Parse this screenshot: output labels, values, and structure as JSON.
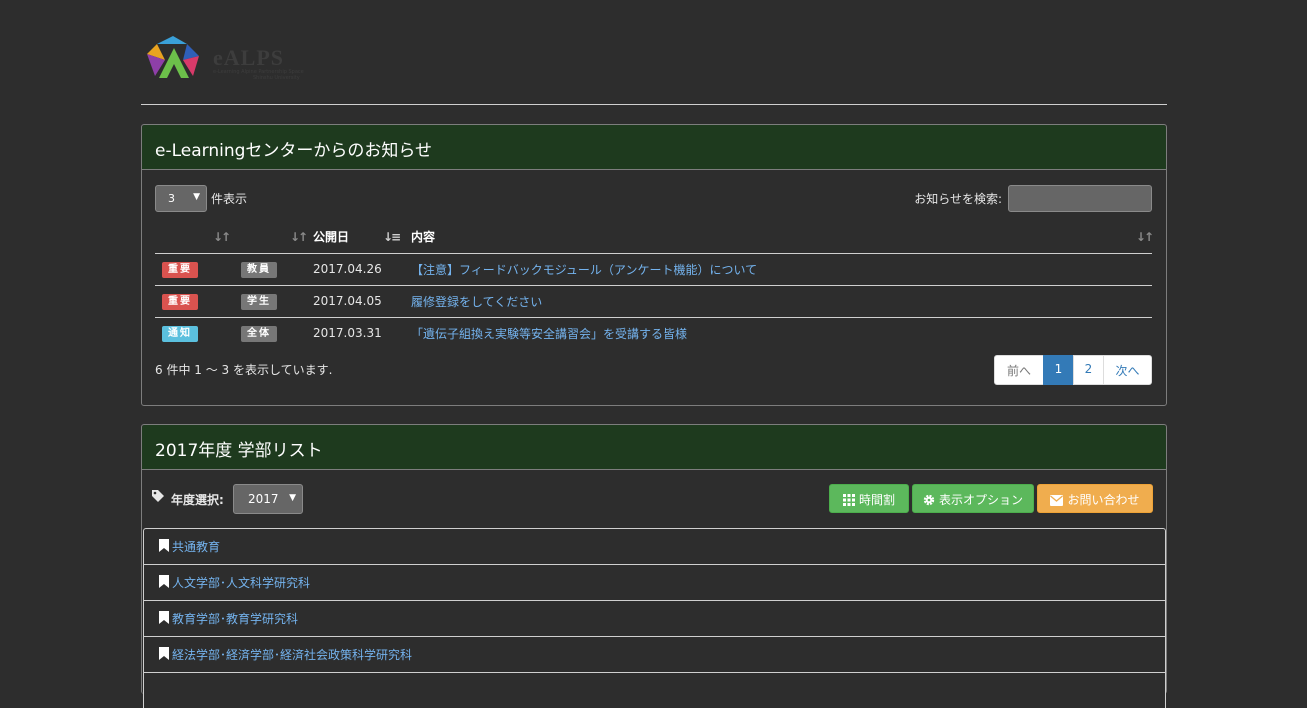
{
  "header": {
    "logo_text": "eALPS",
    "logo_sub1": "e-Learning Alpine Partnership Space",
    "logo_sub2": "Shinshu University"
  },
  "news_panel": {
    "title": "e-Learningセンターからのお知らせ",
    "page_length": "3",
    "page_length_suffix": "件表示",
    "search_label": "お知らせを検索:",
    "search_value": "",
    "columns": [
      "",
      "",
      "公開日",
      "内容"
    ],
    "rows": [
      {
        "importance": "重要",
        "importance_type": "danger",
        "target": "教員",
        "date": "2017.04.26",
        "content": "【注意】フィードバックモジュール（アンケート機能）について"
      },
      {
        "importance": "重要",
        "importance_type": "danger",
        "target": "学生",
        "date": "2017.04.05",
        "content": "履修登録をしてください"
      },
      {
        "importance": "通知",
        "importance_type": "info",
        "target": "全体",
        "date": "2017.03.31",
        "content": "「遺伝子組換え実験等安全講習会」を受講する皆様"
      }
    ],
    "info_text": "6 件中 1 〜 3 を表示しています.",
    "pagination": {
      "prev": "前へ",
      "pages": [
        "1",
        "2"
      ],
      "active_page": "1",
      "next": "次へ"
    }
  },
  "faculty_panel": {
    "title": "2017年度 学部リスト",
    "year_label": "年度選択:",
    "year_value": "2017",
    "buttons": {
      "timetable": "時間割",
      "display_options": "表示オプション",
      "contact": "お問い合わせ"
    },
    "items": [
      "共通教育",
      "人文学部･人文科学研究科",
      "教育学部･教育学研究科",
      "経法学部･経済学部･経済社会政策科学研究科",
      ""
    ]
  },
  "colors": {
    "background": "#2d2d2d",
    "panel_heading": "#1e3a1e",
    "link": "#74b3ee",
    "danger": "#d9534f",
    "info": "#5bc0de",
    "success": "#5cb85c",
    "warning": "#f0ad4e",
    "primary": "#337ab7"
  }
}
